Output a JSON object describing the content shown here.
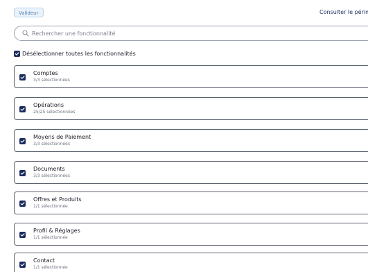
{
  "header": {
    "role_badge": "Valideur",
    "perimeter_link": "Consulter le périmètre"
  },
  "search": {
    "placeholder": "Rechercher une fonctionnalité",
    "value": ""
  },
  "select_all": {
    "label": "Désélectionner toutes les fonctionnalités",
    "checked": true
  },
  "groups": [
    {
      "name": "Comptes",
      "count": "3/3 sélectionnées",
      "checked": true
    },
    {
      "name": "Opérations",
      "count": "25/25 sélectionnées",
      "checked": true
    },
    {
      "name": "Moyens de Paiement",
      "count": "3/3 sélectionnées",
      "checked": true
    },
    {
      "name": "Documents",
      "count": "3/3 sélectionnées",
      "checked": true
    },
    {
      "name": "Offres et Produits",
      "count": "1/1 sélectionnée",
      "checked": true
    },
    {
      "name": "Profil & Réglages",
      "count": "1/1 sélectionnée",
      "checked": true
    },
    {
      "name": "Contact",
      "count": "1/1 sélectionnée",
      "checked": true
    }
  ],
  "colors": {
    "accent": "#1b2b5e",
    "badge_bg": "#eaf3fc",
    "badge_text": "#4f7fb0",
    "border": "#5c6270"
  },
  "icons": {
    "search": "search-icon",
    "checkbox": "checkmark-icon"
  }
}
